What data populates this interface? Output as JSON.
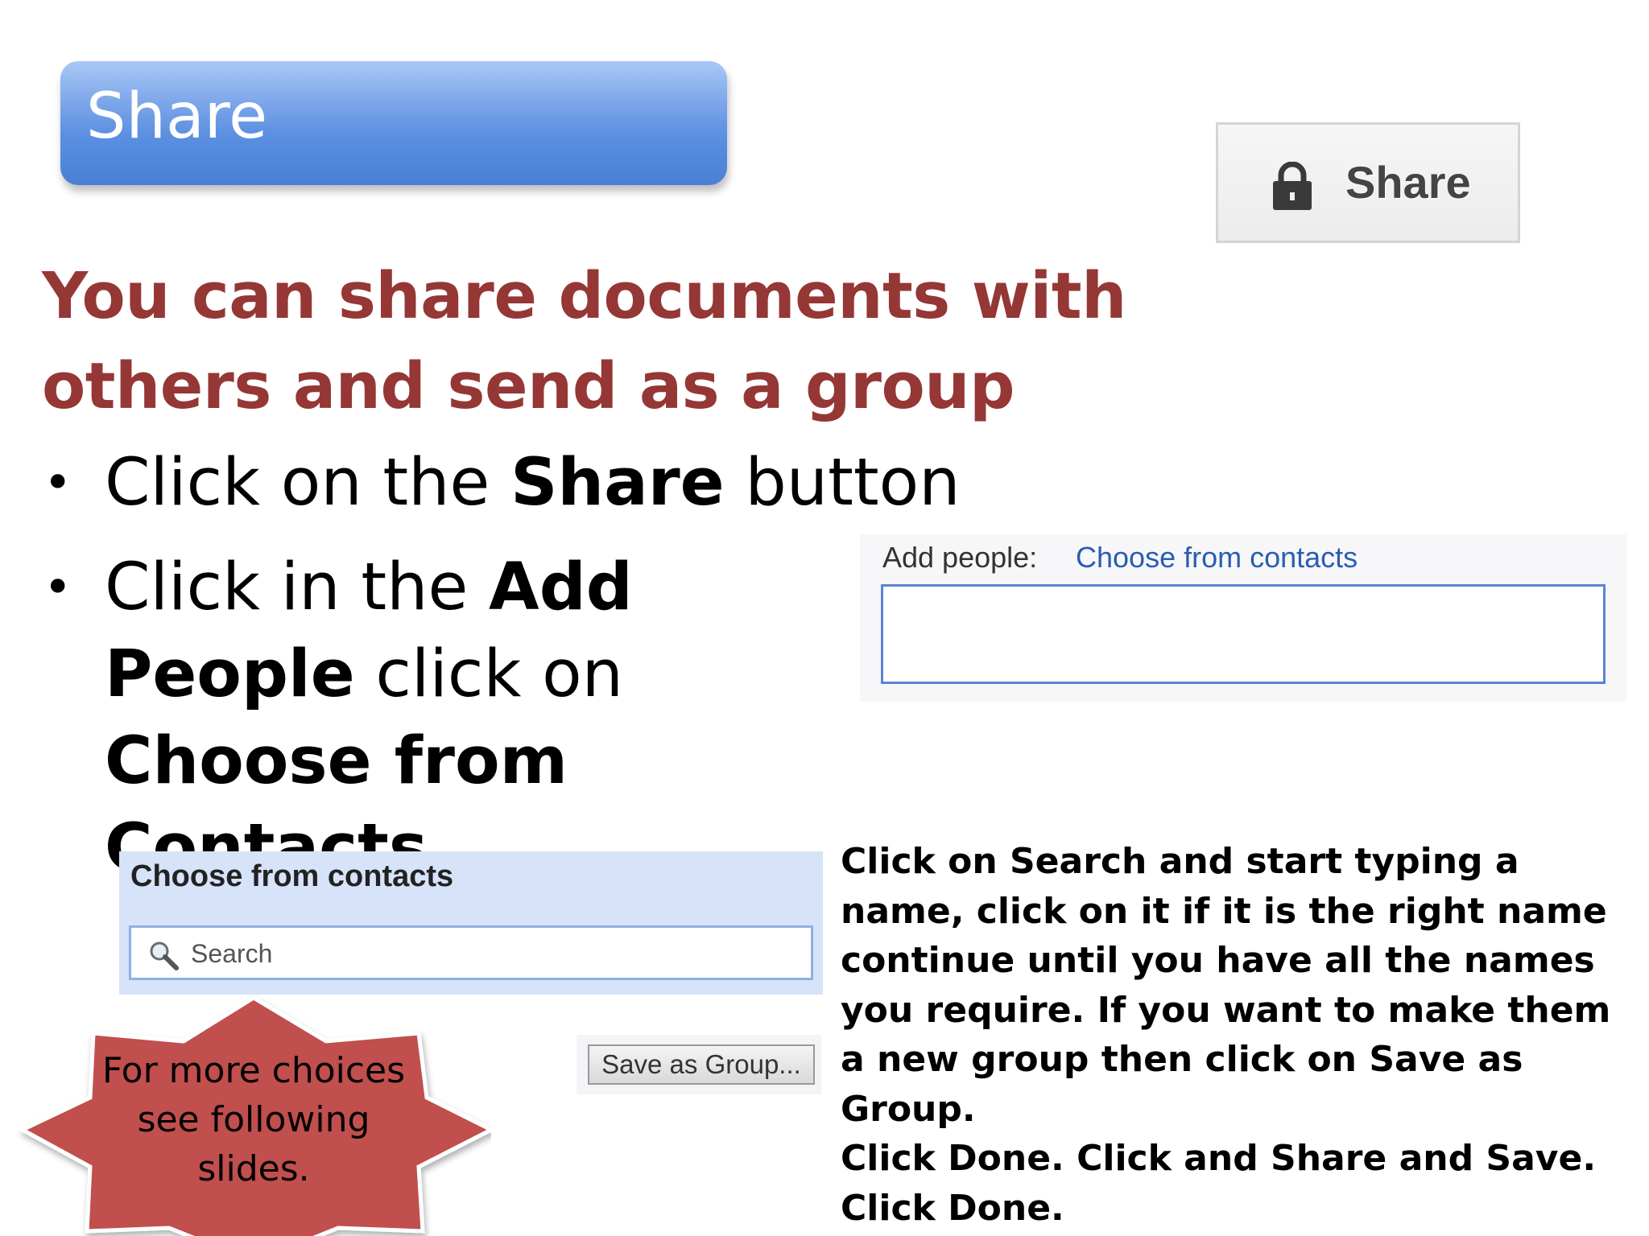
{
  "title": "Share",
  "share_button": {
    "label": "Share",
    "icon": "lock-icon"
  },
  "heading": "You can share documents with others and send as a group",
  "bullets": [
    {
      "pre": "Click on the ",
      "bold": "Share",
      "post": " button"
    },
    {
      "pre": "Click in the ",
      "bold1": "Add People",
      "mid": " click on ",
      "bold2": "Choose from Contacts"
    }
  ],
  "add_people": {
    "label": "Add people:",
    "link": "Choose from contacts",
    "value": ""
  },
  "contacts_panel": {
    "title": "Choose from contacts",
    "search_placeholder": "Search"
  },
  "save_group": {
    "label": "Save as Group..."
  },
  "instructions": {
    "line1": "Click on Search and start typing a name, click on it if it is the right name continue until you have all the names you require. If you want to make them a new group then click on Save as Group.",
    "line2": "Click Done. Click and Share and Save. Click Done."
  },
  "callout": {
    "text": "For more choices see following slides."
  },
  "colors": {
    "heading": "#953735",
    "title_bar": "#5b8fe0",
    "star": "#c0504d",
    "link": "#2a5db0"
  }
}
